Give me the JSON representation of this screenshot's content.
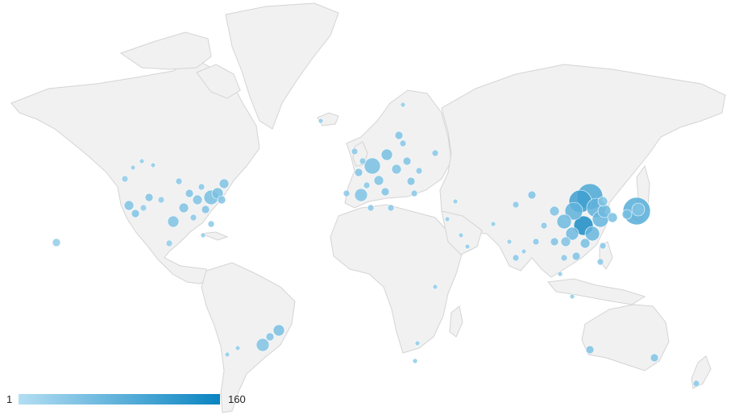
{
  "legend": {
    "min_label": "1",
    "max_label": "160",
    "color_min": "#b3def3",
    "color_max": "#0a84c1"
  },
  "map": {
    "type": "world-bubble-map",
    "land_color": "#f1f1f1",
    "border_color": "#d4d4d4"
  }
}
